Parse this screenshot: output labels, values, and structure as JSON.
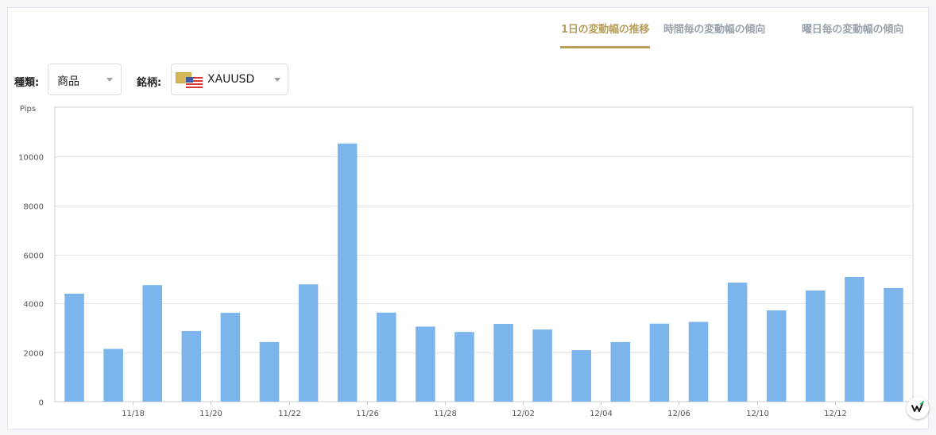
{
  "tabs": [
    {
      "label": "1日の変動幅の推移",
      "active": true
    },
    {
      "label": "時間毎の変動幅の傾向",
      "active": false
    },
    {
      "label": "曜日毎の変動幅の傾向",
      "active": false
    }
  ],
  "filters": {
    "type_label": "種類:",
    "type_value": "商品",
    "symbol_label": "銘柄:",
    "symbol_value": "XAUUSD"
  },
  "colors": {
    "accent": "#b7a05c",
    "bar": "#7cb5ec",
    "grid": "#e6e6e6"
  },
  "chart_data": {
    "type": "bar",
    "unit_label": "Pips",
    "ylim": [
      0,
      12000
    ],
    "y_ticks": [
      0,
      2000,
      4000,
      6000,
      8000,
      10000
    ],
    "x_tick_labels": [
      {
        "label": "11/18",
        "index": 2
      },
      {
        "label": "11/20",
        "index": 4
      },
      {
        "label": "11/22",
        "index": 6
      },
      {
        "label": "11/26",
        "index": 8
      },
      {
        "label": "11/28",
        "index": 10
      },
      {
        "label": "12/02",
        "index": 12
      },
      {
        "label": "12/04",
        "index": 14
      },
      {
        "label": "12/06",
        "index": 16
      },
      {
        "label": "12/10",
        "index": 18
      },
      {
        "label": "12/12",
        "index": 20
      }
    ],
    "values": [
      4400,
      2150,
      4750,
      2880,
      3620,
      2430,
      4780,
      10520,
      3630,
      3060,
      2840,
      3170,
      2940,
      2100,
      2430,
      3180,
      3250,
      4850,
      3720,
      4530,
      5080,
      4630
    ],
    "grid": true,
    "legend": "none"
  }
}
